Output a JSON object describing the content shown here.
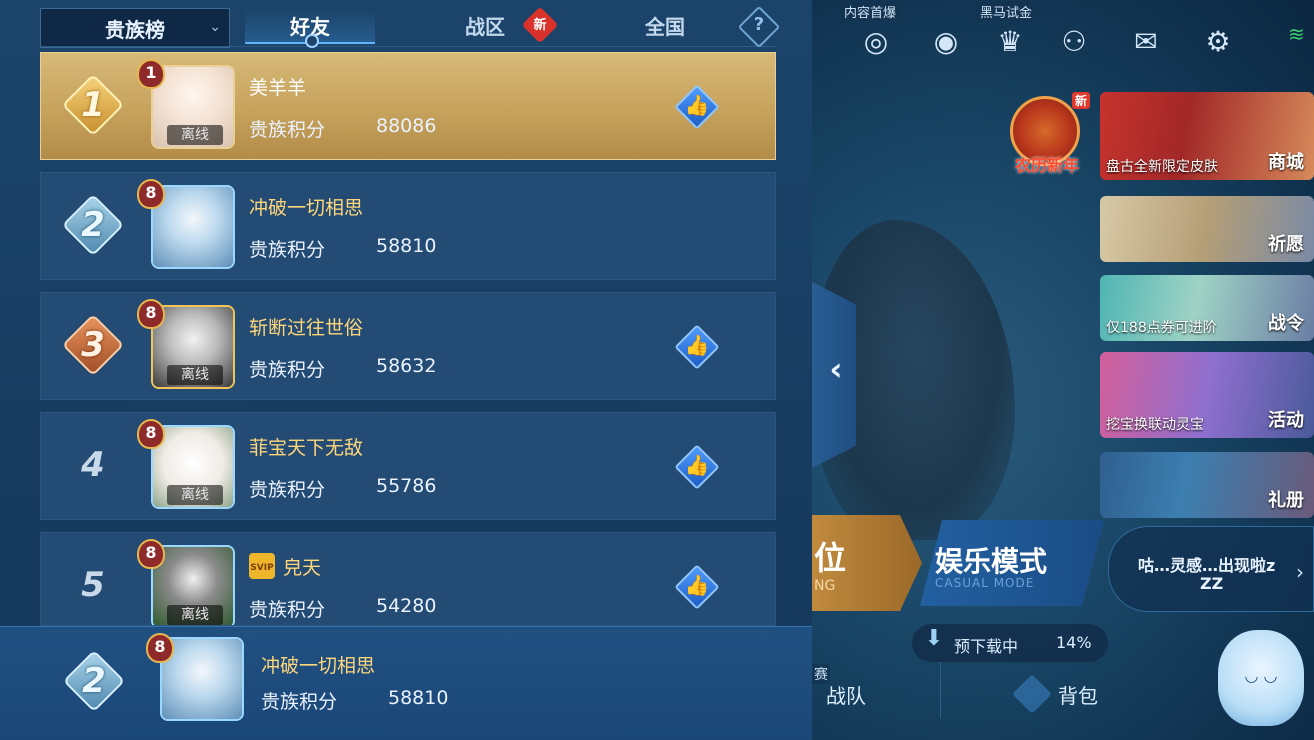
{
  "header": {
    "rank_select": "贵族榜",
    "tabs": [
      {
        "label": "好友",
        "active": true
      },
      {
        "label": "战区",
        "badge": "新"
      },
      {
        "label": "全国"
      }
    ],
    "help": "?"
  },
  "score_label": "贵族积分",
  "offline_label": "离线",
  "players": [
    {
      "rank": "1",
      "level": "1",
      "name": "美羊羊",
      "score": "88086",
      "offline": true,
      "like": true
    },
    {
      "rank": "2",
      "level": "8",
      "name": "冲破一切相思",
      "score": "58810",
      "offline": false,
      "like": false
    },
    {
      "rank": "3",
      "level": "8",
      "name": "斩断过往世俗",
      "score": "58632",
      "offline": true,
      "like": true
    },
    {
      "rank": "4",
      "level": "8",
      "name": "菲宝天下无敌",
      "score": "55786",
      "offline": true,
      "like": true
    },
    {
      "rank": "5",
      "level": "8",
      "name": "皃天",
      "score": "54280",
      "offline": true,
      "like": true,
      "svip": "SVIP"
    }
  ],
  "me": {
    "rank": "2",
    "level": "8",
    "name": "冲破一切相思",
    "score": "58810"
  },
  "top_icons": {
    "captions": [
      "内容首爆",
      "黑马试金"
    ]
  },
  "festival": {
    "label": "农历新年",
    "badge": "新"
  },
  "side_tiles": [
    {
      "caption": "盘古全新限定皮肤",
      "button": "商城"
    },
    {
      "caption": "",
      "button": "祈愿"
    },
    {
      "caption": "仅188点券可进阶",
      "button": "战令"
    },
    {
      "caption": "挖宝换联动灵宝",
      "button": "活动"
    },
    {
      "caption": "",
      "button": "礼册"
    }
  ],
  "modes": {
    "rank_title": "位",
    "rank_sub": "NG",
    "casual_title": "娱乐模式",
    "casual_sub": "CASUAL MODE"
  },
  "mascot": {
    "line1": "咕…灵感…出现啦z",
    "line2": "ZZ"
  },
  "download": {
    "label": "预下载中",
    "percent": "14%"
  },
  "bottom": {
    "team_prefix": "赛",
    "team": "战队",
    "bag": "背包"
  },
  "colors": {
    "gold_row": "#c6a25c",
    "row": "#234b73",
    "name_gold": "#ffd77a",
    "like_blue": "#3f86f0"
  }
}
